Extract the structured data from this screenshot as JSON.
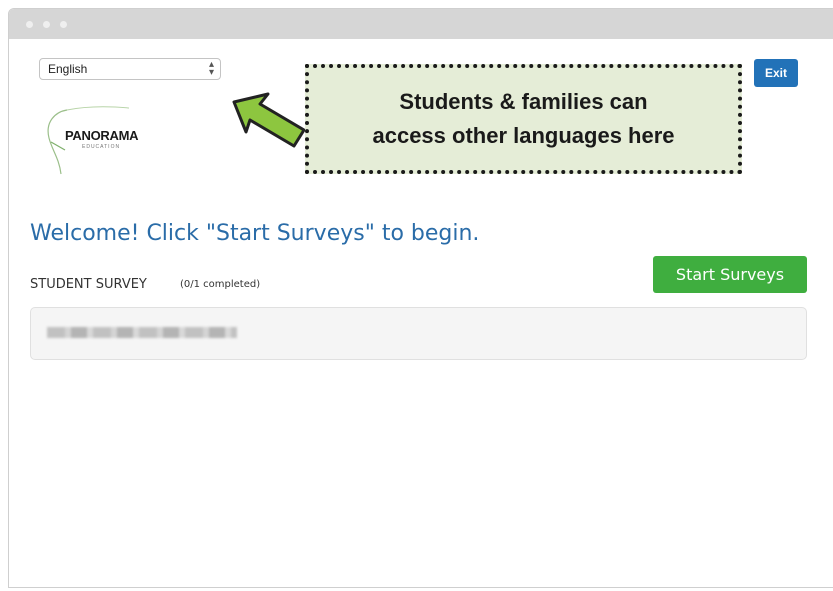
{
  "language_select": {
    "value": "English"
  },
  "logo": {
    "name": "PANORAMA",
    "sub": "EDUCATION"
  },
  "callout": {
    "line1": "Students & families can",
    "line2": "access other languages here"
  },
  "header": {
    "exit_label": "Exit"
  },
  "main": {
    "welcome": "Welcome! Click \"Start Surveys\" to begin.",
    "survey_label": "STUDENT SURVEY",
    "survey_count": "(0/1 completed)",
    "start_label": "Start Surveys"
  },
  "colors": {
    "accent_blue": "#2272b8",
    "welcome_blue": "#2a6ca8",
    "start_green": "#3fae3f",
    "callout_bg": "#e5edd7",
    "arrow_green": "#8dc63f"
  }
}
